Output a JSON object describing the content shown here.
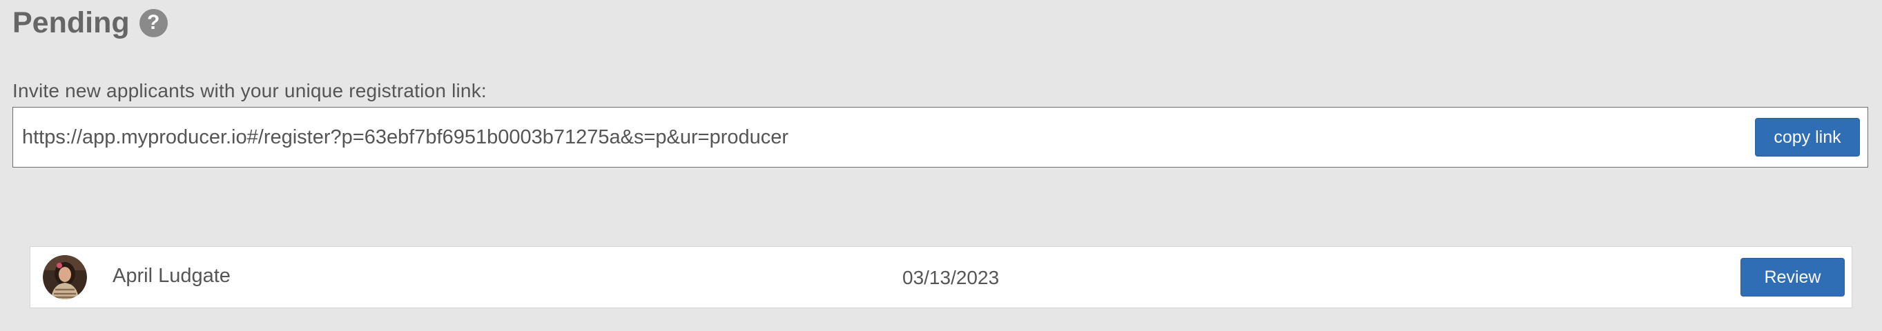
{
  "header": {
    "title": "Pending",
    "help_glyph": "?",
    "help_icon": "question-circle-icon"
  },
  "invite": {
    "label": "Invite new applicants with your unique registration link:",
    "link": "https://app.myproducer.io#/register?p=63ebf7bf6951b0003b71275a&s=p&ur=producer",
    "copy_button_label": "copy link"
  },
  "applicants": [
    {
      "name": "April Ludgate",
      "date": "03/13/2023",
      "review_label": "Review",
      "avatar": "user-photo"
    }
  ],
  "colors": {
    "page_background": "#e6e6e6",
    "button_primary": "#2f6db5",
    "help_icon_bg": "#8a8a8a",
    "text": "#555555"
  }
}
